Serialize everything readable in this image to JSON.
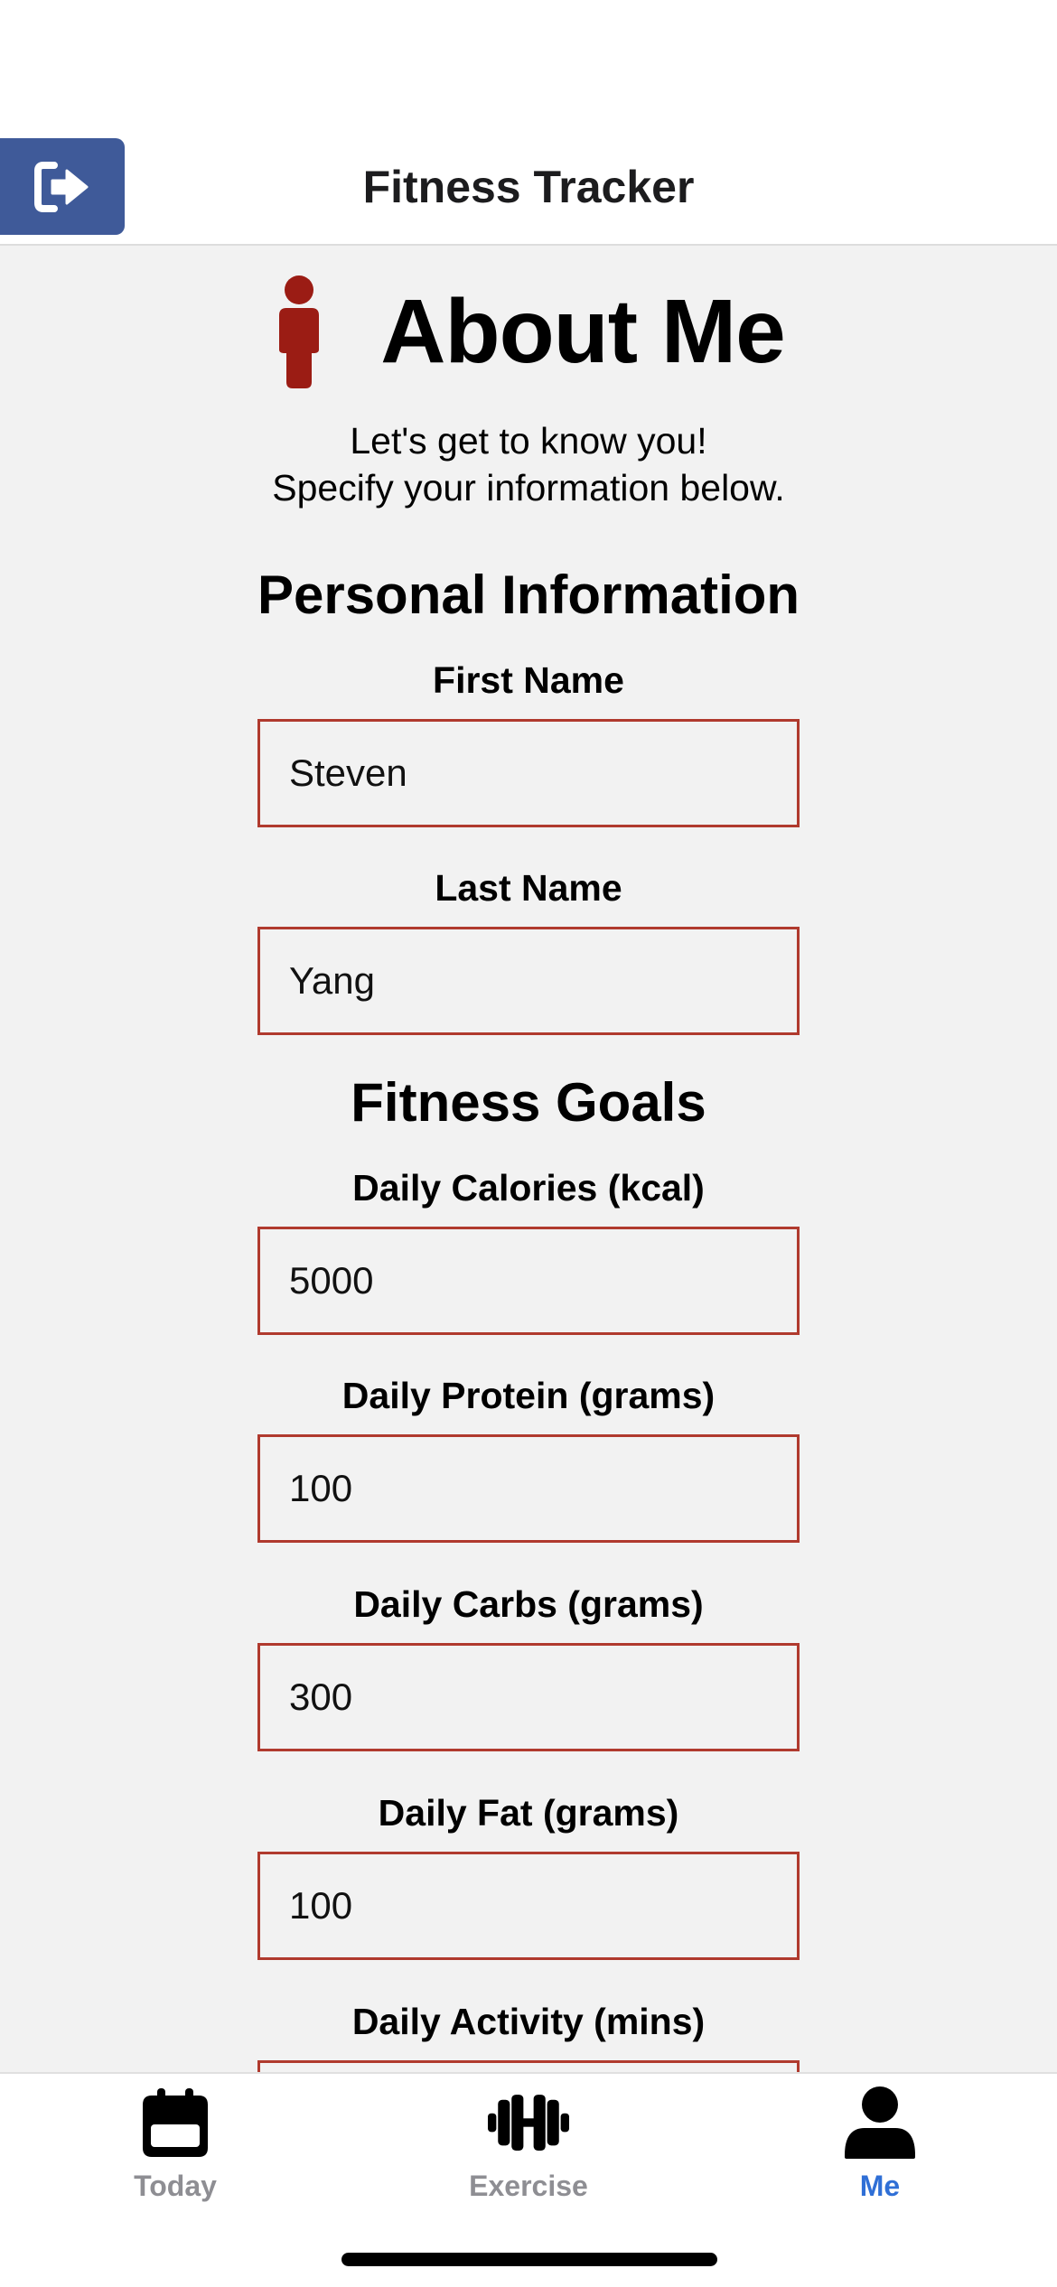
{
  "header": {
    "title": "Fitness Tracker",
    "logout_icon": "sign-out-icon"
  },
  "page": {
    "heading": "About Me",
    "heading_icon": "person-icon",
    "intro_line1": "Let's get to know you!",
    "intro_line2": "Specify your information below."
  },
  "personal": {
    "section_title": "Personal Information",
    "first_name_label": "First Name",
    "first_name_value": "Steven",
    "last_name_label": "Last Name",
    "last_name_value": "Yang"
  },
  "goals": {
    "section_title": "Fitness Goals",
    "calories_label": "Daily Calories (kcal)",
    "calories_value": "5000",
    "protein_label": "Daily Protein (grams)",
    "protein_value": "100",
    "carbs_label": "Daily Carbs (grams)",
    "carbs_value": "300",
    "fat_label": "Daily Fat (grams)",
    "fat_value": "100",
    "activity_label": "Daily Activity (mins)"
  },
  "tabs": [
    {
      "label": "Today",
      "icon": "calendar-icon",
      "active": false
    },
    {
      "label": "Exercise",
      "icon": "dumbbell-icon",
      "active": false
    },
    {
      "label": "Me",
      "icon": "user-icon",
      "active": true
    }
  ],
  "colors": {
    "accent_blue": "#3f5a99",
    "input_border": "#b03a2e",
    "person_icon": "#9b1c14",
    "active_tab": "#2f6fd6",
    "inactive_tab": "#8e8e93",
    "background": "#f2f2f2"
  }
}
